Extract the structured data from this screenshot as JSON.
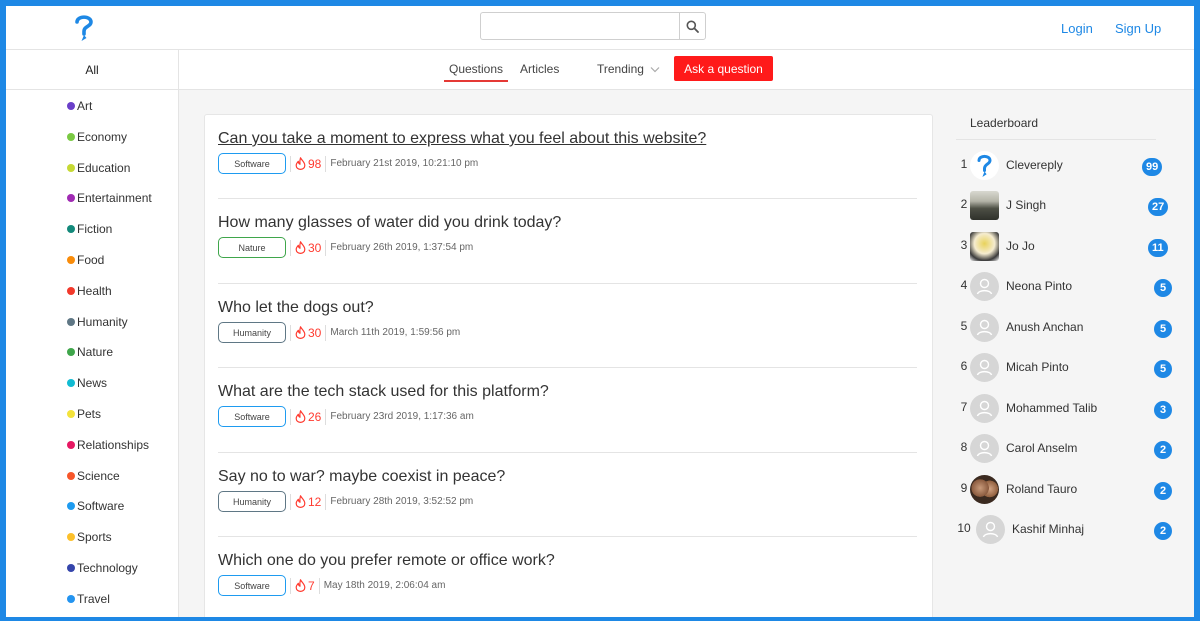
{
  "header": {
    "search_value": "",
    "search_placeholder": "",
    "login_label": "Login",
    "signup_label": "Sign Up"
  },
  "subnav": {
    "all_label": "All",
    "tabs": [
      "Questions",
      "Articles",
      "Trending"
    ],
    "active_tab": "Questions",
    "ask_label": "Ask a question"
  },
  "categories": [
    {
      "label": "Art",
      "color": "#6a3fc9"
    },
    {
      "label": "Economy",
      "color": "#7ac943"
    },
    {
      "label": "Education",
      "color": "#c6d934"
    },
    {
      "label": "Entertainment",
      "color": "#a02bb3"
    },
    {
      "label": "Fiction",
      "color": "#13897a"
    },
    {
      "label": "Food",
      "color": "#f98c0a"
    },
    {
      "label": "Health",
      "color": "#f2392b"
    },
    {
      "label": "Humanity",
      "color": "#5f7785"
    },
    {
      "label": "Nature",
      "color": "#3fa64b"
    },
    {
      "label": "News",
      "color": "#12bcd3"
    },
    {
      "label": "Pets",
      "color": "#f4e33b"
    },
    {
      "label": "Relationships",
      "color": "#e61863"
    },
    {
      "label": "Science",
      "color": "#f7562a"
    },
    {
      "label": "Software",
      "color": "#1e9bf0"
    },
    {
      "label": "Sports",
      "color": "#fcc02b"
    },
    {
      "label": "Technology",
      "color": "#3545ab"
    },
    {
      "label": "Travel",
      "color": "#2394f0"
    }
  ],
  "questions": [
    {
      "title": "Can you take a moment to express what you feel about this website?",
      "tag": "Software",
      "tag_color": "#1e9bf0",
      "score": "98",
      "date": "February 21st 2019, 10:21:10 pm"
    },
    {
      "title": "How many glasses of water did you drink today?",
      "tag": "Nature",
      "tag_color": "#3fa64b",
      "score": "30",
      "date": "February 26th 2019, 1:37:54 pm"
    },
    {
      "title": "Who let the dogs out?",
      "tag": "Humanity",
      "tag_color": "#5f7785",
      "score": "30",
      "date": "March 11th 2019, 1:59:56 pm"
    },
    {
      "title": "What are the tech stack used for this platform?",
      "tag": "Software",
      "tag_color": "#1e9bf0",
      "score": "26",
      "date": "February 23rd 2019, 1:17:36 am"
    },
    {
      "title": "Say no to war? maybe coexist in peace?",
      "tag": "Humanity",
      "tag_color": "#5f7785",
      "score": "12",
      "date": "February 28th 2019, 3:52:52 pm"
    },
    {
      "title": "Which one do you prefer remote or office work?",
      "tag": "Software",
      "tag_color": "#1e9bf0",
      "score": "7",
      "date": "May 18th 2019, 2:06:04 am"
    }
  ],
  "leaderboard": {
    "title": "Leaderboard",
    "entries": [
      {
        "rank": "1",
        "name": "Clevereply",
        "points": "99",
        "avatar": "logo"
      },
      {
        "rank": "2",
        "name": "J Singh",
        "points": "27",
        "avatar": "photo-outdoor"
      },
      {
        "rank": "3",
        "name": "Jo Jo",
        "points": "11",
        "avatar": "photo-illustration"
      },
      {
        "rank": "4",
        "name": "Neona Pinto",
        "points": "5",
        "avatar": "default-user"
      },
      {
        "rank": "5",
        "name": "Anush Anchan",
        "points": "5",
        "avatar": "default-user"
      },
      {
        "rank": "6",
        "name": "Micah Pinto",
        "points": "5",
        "avatar": "default-user"
      },
      {
        "rank": "7",
        "name": "Mohammed Talib",
        "points": "3",
        "avatar": "default-user"
      },
      {
        "rank": "8",
        "name": "Carol Anselm",
        "points": "2",
        "avatar": "default-user"
      },
      {
        "rank": "9",
        "name": "Roland Tauro",
        "points": "2",
        "avatar": "photo-couple"
      },
      {
        "rank": "10",
        "name": "Kashif Minhaj",
        "points": "2",
        "avatar": "default-user"
      }
    ]
  },
  "colors": {
    "accent": "#1e88e5",
    "ask_button": "#ff1a1a",
    "score": "#ff3b30",
    "tab_underline": "#e53935"
  }
}
